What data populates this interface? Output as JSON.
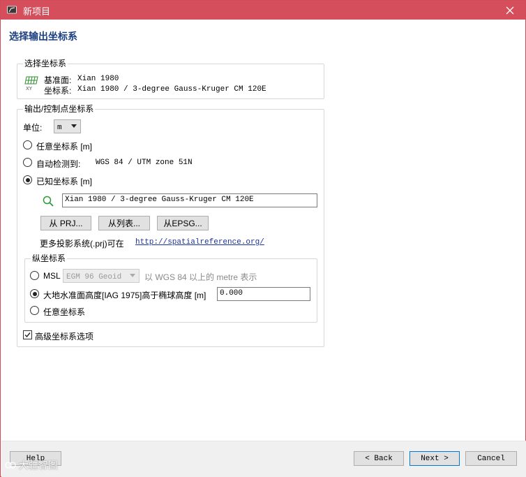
{
  "window": {
    "title": "新项目",
    "accent_color": "#d54e5c"
  },
  "heading": "选择输出坐标系",
  "selected_cs": {
    "legend": "选择坐标系",
    "datum_label": "基准面:",
    "datum_value": "Xian 1980",
    "cs_label": "坐标系:",
    "cs_value": "Xian 1980 / 3-degree Gauss-Kruger CM 120E"
  },
  "output_cs": {
    "legend": "输出/控制点坐标系",
    "unit_label": "单位:",
    "unit_value": "m",
    "options": [
      {
        "label": "任意坐标系 [m]",
        "checked": false
      },
      {
        "label": "自动检测到:",
        "value": "WGS 84 / UTM zone 51N",
        "checked": false
      },
      {
        "label": "已知坐标系 [m]",
        "checked": true
      }
    ],
    "known_cs_value": "Xian 1980 / 3-degree Gauss-Kruger CM 120E",
    "from_prj": "从 PRJ...",
    "from_list": "从列表...",
    "from_epsg": "从EPSG...",
    "more_text": "更多投影系统(.prj)可在",
    "more_link": "http://spatialreference.org/"
  },
  "vertical_cs": {
    "legend": "纵坐标系",
    "msl_label": "MSL",
    "geoid_value": "EGM 96 Geoid",
    "geoid_suffix": "以 WGS 84 以上的 metre 表示",
    "ellipsoid_label": "大地水准面高度[IAG 1975]高于椭球高度 [m]",
    "ellipsoid_value": "0.000",
    "arbitrary_label": "任意坐标系",
    "selected": "ellipsoid"
  },
  "advanced": {
    "label": "高级坐标系选项",
    "checked": true
  },
  "footer": {
    "help": "Help",
    "back": "< Back",
    "next": "Next >",
    "cancel": "Cancel",
    "watermark": "大疆智图"
  }
}
